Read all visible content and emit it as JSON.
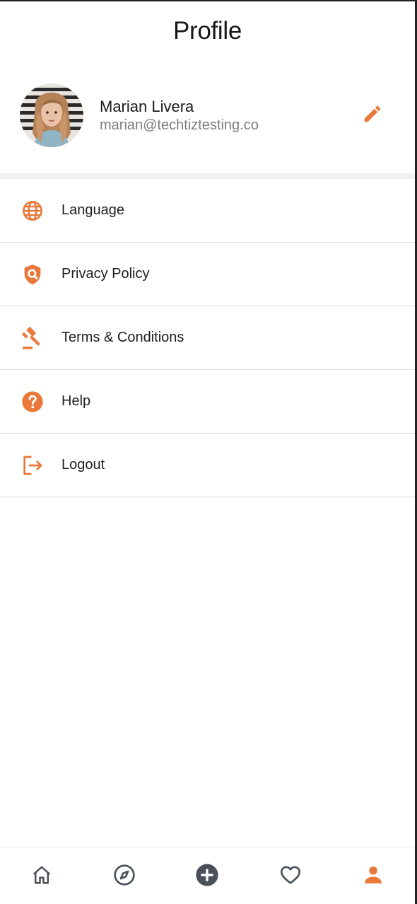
{
  "header": {
    "title": "Profile"
  },
  "user": {
    "name": "Marian Livera",
    "email": "marian@techtiztesting.co"
  },
  "menu": {
    "items": [
      {
        "label": "Language",
        "icon": "globe-icon"
      },
      {
        "label": "Privacy Policy",
        "icon": "shield-search-icon"
      },
      {
        "label": "Terms & Conditions",
        "icon": "gavel-icon"
      },
      {
        "label": "Help",
        "icon": "help-circle-icon"
      },
      {
        "label": "Logout",
        "icon": "logout-icon"
      }
    ]
  },
  "bottom_nav": {
    "items": [
      {
        "icon": "home-icon",
        "active": false
      },
      {
        "icon": "compass-icon",
        "active": false
      },
      {
        "icon": "add-circle-icon",
        "active": false
      },
      {
        "icon": "heart-icon",
        "active": false
      },
      {
        "icon": "person-icon",
        "active": true
      }
    ]
  },
  "colors": {
    "accent": "#e8793a",
    "inactive_icon": "#4a5059",
    "text_primary": "#1e1e1e",
    "text_secondary": "#7d7d7d"
  }
}
